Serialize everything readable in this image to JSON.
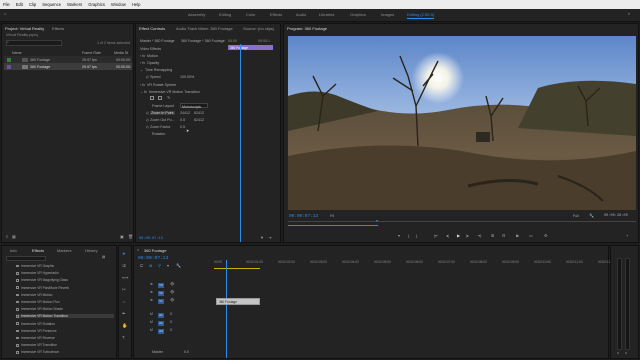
{
  "menu": [
    "File",
    "Edit",
    "Clip",
    "Sequence",
    "Markers",
    "Graphics",
    "Window",
    "Help"
  ],
  "workspaces": [
    "Assembly",
    "Editing",
    "Color",
    "Effects",
    "Audio",
    "Libraries",
    "Graphics",
    "Images",
    "Editing (CS5.5)"
  ],
  "workspace_active": "Editing (CS5.5)",
  "project": {
    "title": "Project: Virtual Reality",
    "tab2": "Effects",
    "file": "Virtual Reality.prproj",
    "selection_info": "1 of 2 items selected",
    "search_placeholder": "",
    "columns": [
      "Name",
      "Frame Rate",
      "Media St"
    ],
    "items": [
      {
        "name": "360 Footage",
        "fps": "29.97 fps",
        "start": "00:00:00:"
      },
      {
        "name": "360 Footage",
        "fps": "29.97 fps",
        "start": "00:00:00:"
      }
    ]
  },
  "effect_controls": {
    "tabs": [
      "Effect Controls",
      "Audio Track Mixer: 360 Footage",
      "Source: (no clips)"
    ],
    "source_label": "Master * 360 Footage",
    "clip_label": "360 Footage * 360 Footage",
    "timecode_ruler": [
      "00:00",
      "00:00:1"
    ],
    "clip_bar": "360 Footage",
    "sections": [
      "Video Effects",
      "Motion",
      "Opacity",
      "Time Remapping",
      "Speed",
      "VR Rotate Sphere",
      "Immersive VR Motion Transition"
    ],
    "speed_value": "100.00%",
    "params": [
      {
        "label": "Frame Layout",
        "value": "Monoscopic"
      },
      {
        "label": "Zoom In Point",
        "value": "24412",
        "value2": "62412"
      },
      {
        "label": "Zoom Out Po...",
        "value": "0.5",
        "value2": "62412"
      },
      {
        "label": "Zoom Factor",
        "value": "0.5"
      },
      {
        "label": "Rotation",
        "value": ""
      }
    ],
    "timecode": "00:00:07:13"
  },
  "program": {
    "title": "Program: 360 Footage",
    "timecode_current": "00:00:07:13",
    "fit": "Fit",
    "quality": "Full",
    "timecode_total": "00:00:28:00",
    "controls": [
      "marker",
      "in",
      "out",
      "go-in",
      "step-back",
      "play",
      "step-fwd",
      "go-out",
      "insert",
      "overwrite",
      "camera",
      "vr",
      "settings",
      "add"
    ]
  },
  "effects_panel": {
    "tabs": [
      "Info",
      "Effects",
      "Markers",
      "History"
    ],
    "items": [
      "Immersive VR Graphic",
      "Immersive VR Hypertadio",
      "Immersive VR Magnifying Glass",
      "Immersive VR Pan/Move Reverb",
      "Immersive VR Motion",
      "Immersive VR Motion Flux",
      "Immersive VR Motion Shade",
      "Immersive VR Motion Transition",
      "Immersive VR Rotation",
      "Immersive VR Presence",
      "Immersive VR Reverse",
      "Immersive VR Transition",
      "Immersive VR Turbulence"
    ],
    "selected_index": 7
  },
  "timeline": {
    "title": "360 Footage",
    "timecode": "00:00:07:13",
    "ruler": [
      "00:00",
      "00:00:01:00",
      "00:00:02:00",
      "00:00:03:00",
      "00:00:04:00",
      "00:00:05:00",
      "00:00:06:00",
      "00:00:07:00",
      "00:00:08:00",
      "00:00:09:00",
      "00:00:10:00",
      "00:00:11:00",
      "00:00:12:00"
    ],
    "video_tracks": [
      "V3",
      "V2",
      "V1"
    ],
    "audio_tracks": [
      "A1",
      "A2",
      "A3"
    ],
    "clip_label": "360 Footage",
    "master_label": "Master",
    "master_value": "0.0"
  },
  "colors": {
    "accent": "#2d8ceb",
    "panel": "#232323",
    "bg": "#1d1d1d",
    "clip": "#c4c4c4",
    "clip_purple": "#8b6fcf"
  }
}
